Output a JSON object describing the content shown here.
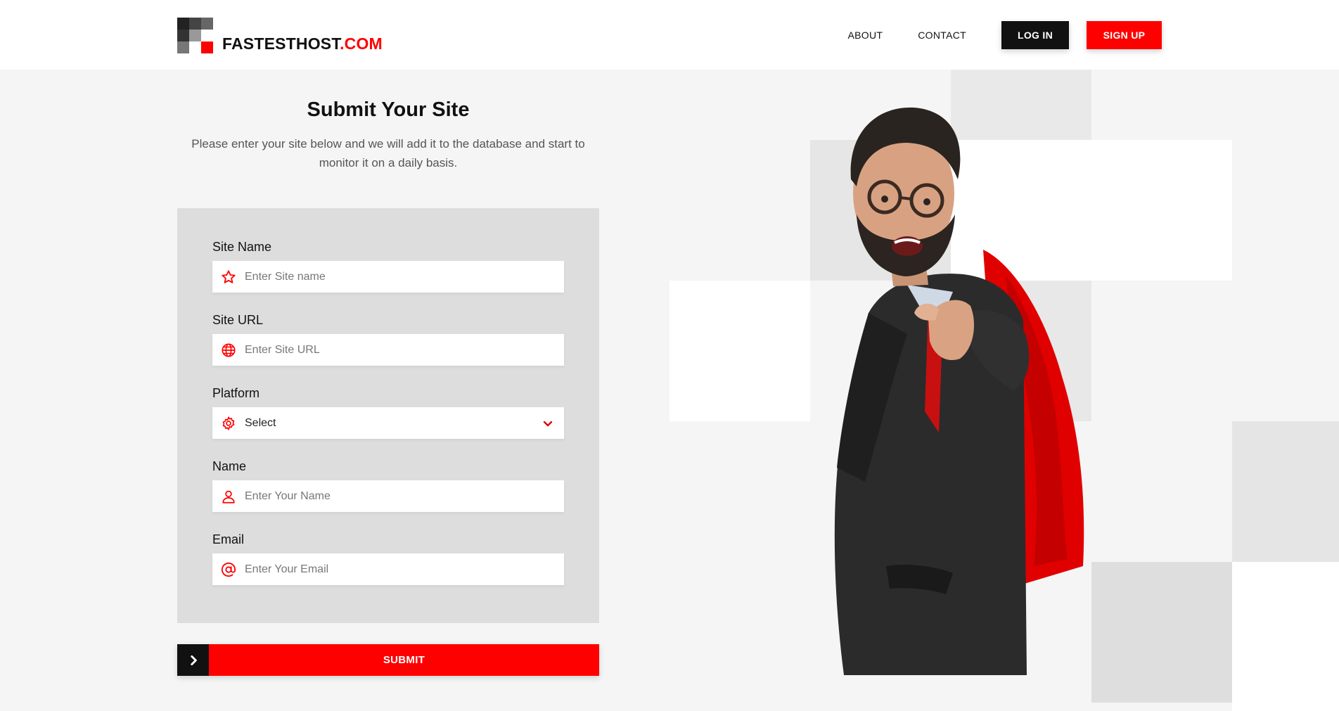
{
  "brand": {
    "name_main": "FASTESTHOST",
    "name_accent": ".COM",
    "accent_color": "#ff0000",
    "dark_color": "#111111"
  },
  "nav": {
    "about": "ABOUT",
    "contact": "CONTACT",
    "login": "LOG IN",
    "signup": "SIGN UP"
  },
  "page": {
    "title": "Submit Your Site",
    "description": "Please enter your site below and we will add it to the database and start to monitor it on a daily basis."
  },
  "form": {
    "site_name": {
      "label": "Site Name",
      "placeholder": "Enter Site name",
      "icon": "star-icon"
    },
    "site_url": {
      "label": "Site URL",
      "placeholder": "Enter Site URL",
      "icon": "globe-icon"
    },
    "platform": {
      "label": "Platform",
      "value": "Select",
      "icon": "gear-icon"
    },
    "name": {
      "label": "Name",
      "placeholder": "Enter Your Name",
      "icon": "user-icon"
    },
    "email": {
      "label": "Email",
      "placeholder": "Enter Your Email",
      "icon": "at-sign-icon"
    },
    "submit": "SUBMIT"
  }
}
